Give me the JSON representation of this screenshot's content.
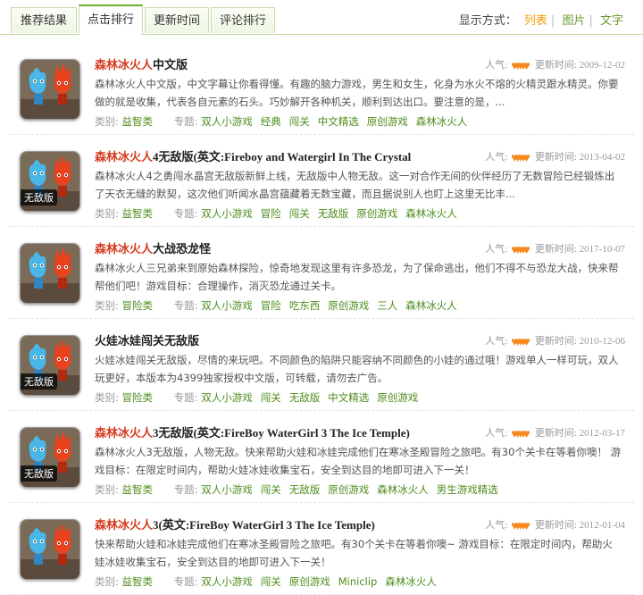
{
  "tabs": [
    {
      "label": "推荐结果",
      "active": false
    },
    {
      "label": "点击排行",
      "active": true
    },
    {
      "label": "更新时间",
      "active": false
    },
    {
      "label": "评论排行",
      "active": false
    }
  ],
  "view_mode": {
    "label": "显示方式：",
    "options": [
      "列表",
      "图片",
      "文字"
    ],
    "selected": "列表"
  },
  "labels": {
    "popularity": "人气:",
    "updated": "更新时间:",
    "category": "类别:",
    "topic": "专题:"
  },
  "rating_hearts": 5,
  "colors": {
    "accent": "#6fae32",
    "highlight": "#d63a1e",
    "heart": "#f5891f",
    "link": "#4e8d1d",
    "active_view": "#f39800"
  },
  "items": [
    {
      "title_hl": "森林冰火人",
      "title_rest": "中文版",
      "date": "2009-12-02",
      "badge": "",
      "desc": "森林冰火人中文版，中文字幕让你看得懂。有趣的脑力游戏，男生和女生，化身为水火不熔的火精灵跟水精灵。你要做的就是收集，代表各自元素的石头。巧妙解开各种机关，顺利到达出口。要注意的是，...",
      "category": "益智类",
      "topics": [
        "双人小游戏",
        "经典",
        "闯关",
        "中文精选",
        "原创游戏",
        "森林冰火人"
      ]
    },
    {
      "title_hl": "森林冰火人",
      "title_rest": "4无敌版(英文:Fireboy and Watergirl In The Crystal",
      "date": "2013-04-02",
      "badge": "无敌版",
      "desc": "森林冰火人4之勇闯水晶宫无敌版新鲜上线，无敌版中人物无敌。这一对合作无间的伙伴经历了无数冒险已经锻炼出了天衣无缝的默契，这次他们听闻水晶宫蕴藏着无数宝藏，而且据说别人也盯上这里无比丰...",
      "category": "益智类",
      "topics": [
        "双人小游戏",
        "冒险",
        "闯关",
        "无敌版",
        "原创游戏",
        "森林冰火人"
      ]
    },
    {
      "title_hl": "森林冰火人",
      "title_rest": "大战恐龙怪",
      "date": "2017-10-07",
      "badge": "",
      "desc": "森林冰火人三兄弟来到原始森林探险，惊奇地发现这里有许多恐龙，为了保命逃出，他们不得不与恐龙大战，快来帮帮他们吧！游戏目标：合理操作，消灭恐龙通过关卡。",
      "category": "冒险类",
      "topics": [
        "双人小游戏",
        "冒险",
        "吃东西",
        "原创游戏",
        "三人",
        "森林冰火人"
      ]
    },
    {
      "title_hl": "",
      "title_rest": "火娃冰娃闯关无敌版",
      "date": "2010-12-06",
      "badge": "无敌版",
      "desc": "火娃冰娃闯关无敌版，尽情的来玩吧。不同颜色的陷阱只能容纳不同颜色的小娃的通过哦！游戏单人一样可玩，双人玩更好，本版本为4399独家授权中文版，可转载，请勿去广告。",
      "category": "冒险类",
      "topics": [
        "双人小游戏",
        "闯关",
        "无敌版",
        "中文精选",
        "原创游戏"
      ]
    },
    {
      "title_hl": "森林冰火人",
      "title_rest": "3无敌版(英文:FireBoy WaterGirl 3 The Ice Temple)",
      "date": "2012-03-17",
      "badge": "无敌版",
      "desc": "森林冰火人3无敌版，人物无敌。快来帮助火娃和冰娃完成他们在寒冰圣殿冒险之旅吧。有30个关卡在等着你噢！ 游戏目标：在限定时间内，帮助火娃冰娃收集宝石，安全到达目的地即可进入下一关！",
      "category": "益智类",
      "topics": [
        "双人小游戏",
        "闯关",
        "无敌版",
        "原创游戏",
        "森林冰火人",
        "男生游戏精选"
      ]
    },
    {
      "title_hl": "森林冰火人",
      "title_rest": "3(英文:FireBoy WaterGirl 3 The Ice Temple)",
      "date": "2012-01-04",
      "badge": "",
      "desc": "快来帮助火娃和冰娃完成他们在寒冰圣殿冒险之旅吧。有30个关卡在等着你噢~ 游戏目标：在限定时间内，帮助火娃冰娃收集宝石，安全到达目的地即可进入下一关！",
      "category": "益智类",
      "topics": [
        "双人小游戏",
        "闯关",
        "原创游戏",
        "Miniclip",
        "森林冰火人"
      ]
    }
  ]
}
